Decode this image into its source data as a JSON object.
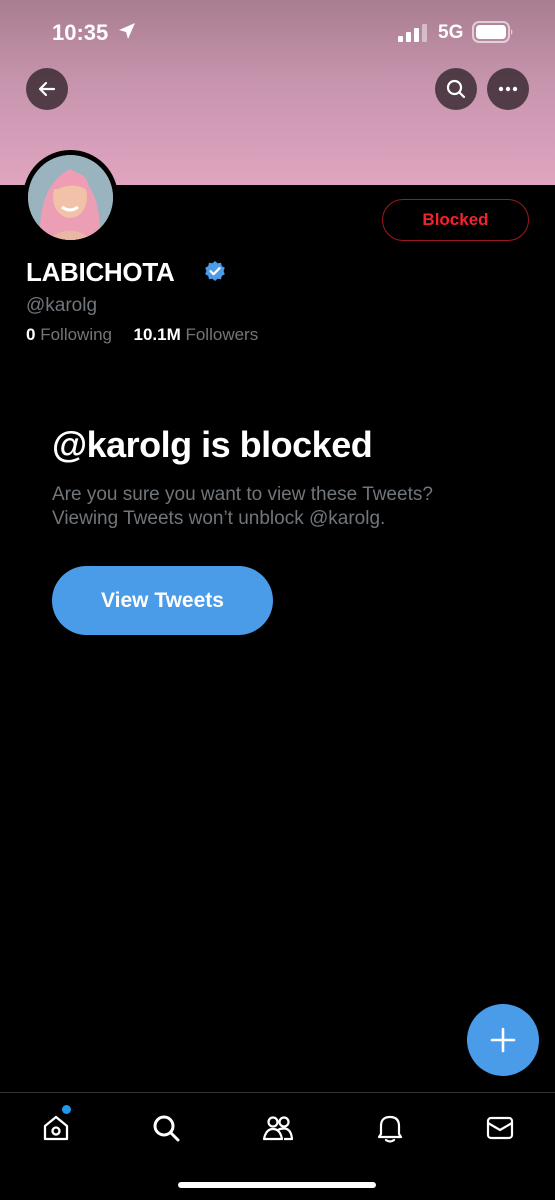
{
  "status_bar": {
    "time": "10:35",
    "network": "5G",
    "location_icon": "location-arrow-icon",
    "signal_icon": "cellular-signal-icon",
    "battery_icon": "battery-icon"
  },
  "header": {
    "back_icon": "arrow-left-icon",
    "search_icon": "search-icon",
    "more_icon": "ellipsis-icon",
    "banner_color": "#d99cb8"
  },
  "profile": {
    "display_name": "LABICHOTA",
    "handle": "@karolg",
    "verified_icon": "verified-badge-icon",
    "following_count": "0",
    "following_label": "Following",
    "followers_count": "10.1M",
    "followers_label": "Followers",
    "relationship_button": "Blocked"
  },
  "blocked_notice": {
    "title": "@karolg is blocked",
    "description": "Are you sure you want to view these Tweets? Viewing Tweets won’t unblock @karolg.",
    "button_label": "View Tweets"
  },
  "fab": {
    "icon": "plus-icon"
  },
  "tab_bar": {
    "items": [
      {
        "name": "home",
        "icon": "home-icon",
        "has_badge": true
      },
      {
        "name": "search",
        "icon": "search-icon"
      },
      {
        "name": "communities",
        "icon": "communities-icon"
      },
      {
        "name": "notifications",
        "icon": "bell-icon"
      },
      {
        "name": "messages",
        "icon": "envelope-icon"
      }
    ]
  },
  "colors": {
    "accent": "#4a9be8",
    "blocked_red": "#f4212e",
    "muted_text": "#71767b",
    "background": "#000000"
  }
}
